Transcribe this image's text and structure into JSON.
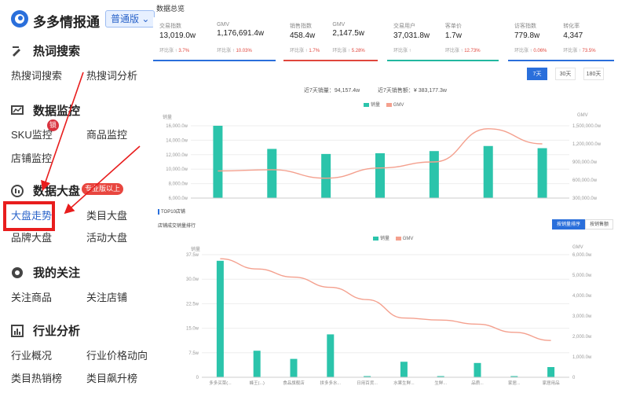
{
  "brand": {
    "name": "多多情报通",
    "version": "普通版"
  },
  "sidebar": {
    "sections": [
      {
        "title": "热词搜索",
        "items": [
          "热搜词搜索",
          "热搜词分析"
        ]
      },
      {
        "title": "数据监控",
        "items": [
          "SKU监控",
          "商品监控",
          "店铺监控"
        ],
        "badge": "锁"
      },
      {
        "title": "数据大盘",
        "badge": "专业版以上",
        "items": [
          "大盘走势",
          "类目大盘",
          "品牌大盘",
          "活动大盘"
        ]
      },
      {
        "title": "我的关注",
        "items": [
          "关注商品",
          "关注店铺"
        ]
      },
      {
        "title": "行业分析",
        "items": [
          "行业概况",
          "行业价格动向",
          "类目热销榜",
          "类目飙升榜"
        ]
      }
    ],
    "active_item": "大盘走势"
  },
  "overview": {
    "title": "数据总览",
    "cards": [
      {
        "color": "#2a6fdb",
        "cells": [
          {
            "label": "交易指数",
            "value": "13,019.0w"
          },
          {
            "label": "GMV",
            "value": "1,176,691.4w"
          }
        ],
        "ratios": [
          {
            "text": "环比涨",
            "value": "3.7%"
          },
          {
            "text": "环比涨",
            "value": "10.03%"
          }
        ]
      },
      {
        "color": "#e0463c",
        "cells": [
          {
            "label": "销售指数",
            "value": "458.4w"
          },
          {
            "label": "GMV",
            "value": "2,147.5w"
          }
        ],
        "ratios": [
          {
            "text": "环比涨",
            "value": "1.7%"
          },
          {
            "text": "环比涨",
            "value": "5.28%"
          }
        ]
      },
      {
        "color": "#22b8a0",
        "cells": [
          {
            "label": "交易用户",
            "value": "37,031.8w"
          },
          {
            "label": "客单价",
            "value": "1.7w"
          }
        ],
        "ratios": [
          {
            "text": "环比涨",
            "value": ""
          },
          {
            "text": "环比涨",
            "value": "12.73%"
          }
        ]
      },
      {
        "color": "#2a6fdb",
        "cells": [
          {
            "label": "访客指数",
            "value": "779.8w"
          },
          {
            "label": "转化率",
            "value": "4,347"
          }
        ],
        "ratios": [
          {
            "text": "环比涨",
            "value": "0.06%"
          },
          {
            "text": "环比涨",
            "value": "73.5%"
          }
        ]
      }
    ]
  },
  "range_buttons": [
    "7天",
    "30天",
    "180天"
  ],
  "range_active": "7天",
  "summary": {
    "sales": "近7天销量：94,157.4w",
    "gmv": "近7天销售额：¥ 383,177.3w"
  },
  "legend": {
    "bar": "销量",
    "line": "GMV"
  },
  "colors": {
    "bar": "#2bc4ab",
    "line": "#f4a08e",
    "accent": "#2a6fdb",
    "highlight": "#e81d1d"
  },
  "top10": {
    "title": "TOP10店铺",
    "subtitle": "店铺成交销量排行",
    "tabs": [
      "按销量排序",
      "按销售额"
    ],
    "active_tab": "按销量排序"
  },
  "chart_data": [
    {
      "type": "bar",
      "series": [
        {
          "name": "销量",
          "values": [
            16000,
            12800,
            12100,
            12200,
            12500,
            13200,
            12900
          ]
        },
        {
          "name": "GMV",
          "values": [
            750000,
            770000,
            630000,
            800000,
            900000,
            1450000,
            1200000
          ]
        }
      ],
      "ylabel": "销量",
      "y2label": "GMV",
      "ylim": [
        6000,
        16000
      ],
      "y_ticks": [
        "16,000.0w",
        "14,000.0w",
        "12,000.0w",
        "10,000.0w",
        "8,000.0w",
        "6,000.0w"
      ],
      "y2lim": [
        300000,
        1500000
      ],
      "y2_ticks": [
        "1,500,000.0w",
        "1,200,000.0w",
        "900,000.0w",
        "600,000.0w",
        "300,000.0w"
      ],
      "legend_position": "top"
    },
    {
      "type": "bar",
      "series": [
        {
          "name": "销量",
          "values": [
            28500,
            6500,
            4500,
            10500,
            100,
            3800,
            200,
            3500,
            200,
            2500
          ]
        },
        {
          "name": "GMV",
          "values": [
            5800,
            5300,
            4900,
            4400,
            3800,
            2900,
            2800,
            2600,
            2200,
            1800
          ]
        }
      ],
      "categories": [
        "多多买菜(...",
        "蜂王(...)",
        "食品旗舰店",
        "拼多多水...",
        "日用百货...",
        "水果生鲜...",
        "生鲜...",
        "品质...",
        "家居...",
        "家居用品"
      ],
      "ylabel": "销量",
      "y2label": "GMV",
      "ylim": [
        0,
        30000
      ],
      "y_ticks": [
        "37.5w",
        "30.0w",
        "22.5w",
        "15.0w",
        "7.5w",
        "0"
      ],
      "y2lim": [
        0,
        6000
      ],
      "y2_ticks": [
        "6,000.0w",
        "5,000.0w",
        "4,000.0w",
        "3,000.0w",
        "2,000.0w",
        "1,000.0w",
        "0"
      ],
      "legend_position": "top"
    }
  ]
}
